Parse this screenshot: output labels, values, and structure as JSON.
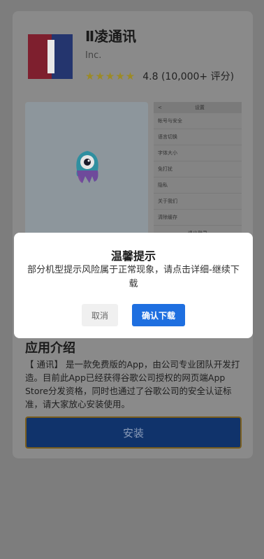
{
  "app": {
    "name": "Ⅱ凌通讯",
    "developer": "Inc.",
    "stars": "★★★★★",
    "rating": "4.8 (10,000+ 评分)"
  },
  "screenshot_right": {
    "top_back": "<",
    "top_title": "设置",
    "rows": [
      "帐号与安全",
      "语言切换",
      "字体大小",
      "免打扰",
      "隐私",
      "关于我们",
      "清除缓存"
    ],
    "bottom": "退出登录"
  },
  "intro": {
    "title": "应用介绍",
    "text": "【 通讯】 是一款免费版的App，由公司专业团队开发打造。目前此App已经获得谷歌公司授权的网页端App Store分发资格，同时也通过了谷歌公司的安全认证标准，请大家放心安装使用。"
  },
  "install_label": "安装",
  "modal": {
    "title": "温馨提示",
    "message": "部分机型提示风险属于正常现象，请点击详细-继续下载",
    "cancel": "取消",
    "confirm": "确认下载"
  },
  "colors": {
    "overlay_bg": "#7d7d7d",
    "confirm_blue": "#1e6fe0",
    "install_blue": "#10336b",
    "icon_red": "#7e1f2e",
    "icon_blue": "#24356e"
  }
}
